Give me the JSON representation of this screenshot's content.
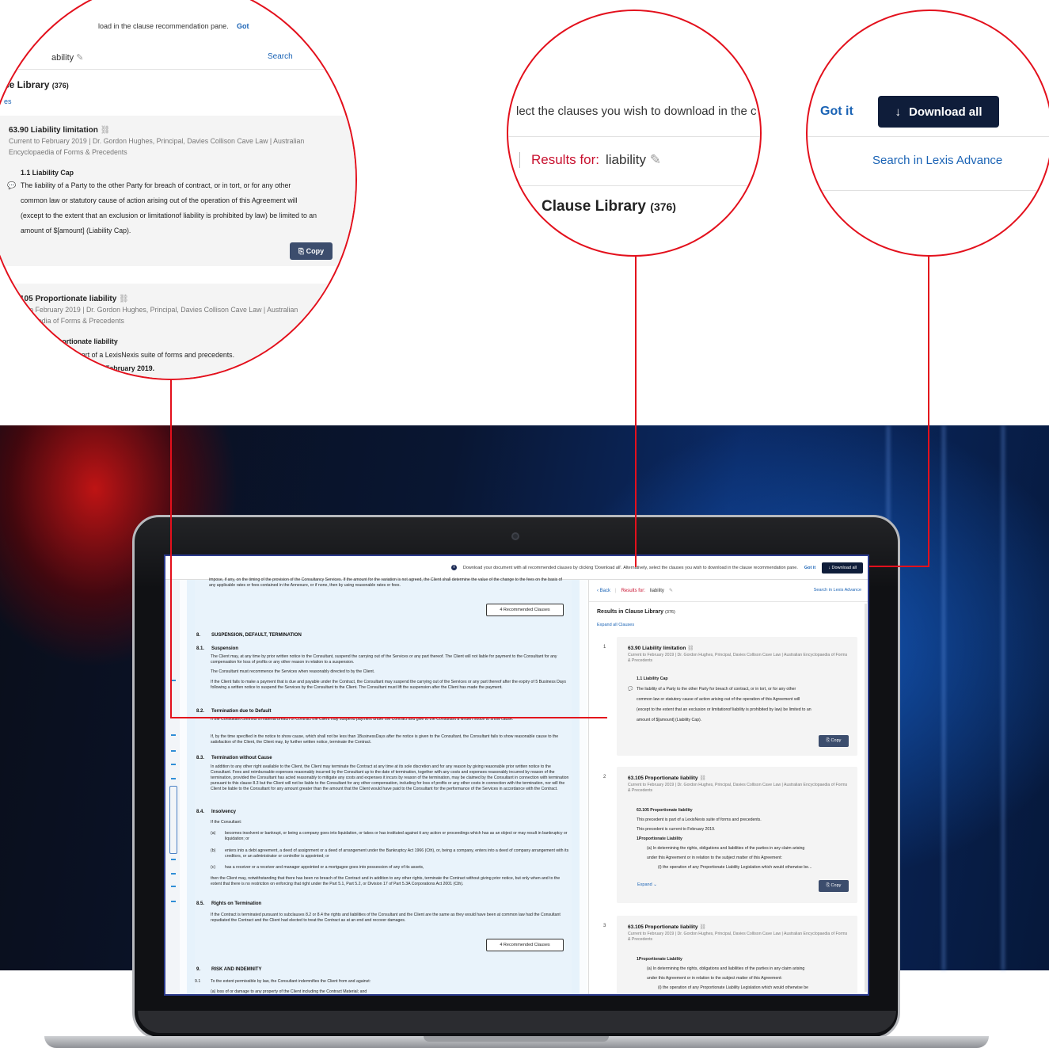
{
  "notice": {
    "text": "Download your document with all recommended clauses by clicking 'Download all'. Alternatively, select the clauses you wish to download in the clause recommendation pane.",
    "got_it": "Got it",
    "download_all": "Download all"
  },
  "doc": {
    "intro": "impose, if any, on the timing of the provision of the Consultancy Services. If the amount for the variation is not agreed, the Client shall determine the value of the change to the fees on the basis of any applicable rates or fees contained in the Annexure, or if none, then by using reasonable rates or fees.",
    "rec_button": "4 Recommended Clauses",
    "sec8_num": "8.",
    "sec8_title": "SUSPENSION, DEFAULT, TERMINATION",
    "s81_num": "8.1.",
    "s81_title": "Suspension",
    "s81_p1": "The Client may, at any time by prior written notice to the Consultant, suspend the carrying out of the Services or any part thereof. The Client will not liable for payment to the Consultant for any compensation for loss of profits or any other reason in relation to a suspension.",
    "s81_p2": "The Consultant must recommence the Services when reasonably directed to by the Client.",
    "s81_p3": "If the Client fails to make a payment that is due and payable under the Contract, the Consultant may suspend the carrying out of the Services or any part thereof after the expiry of 5 Business Days following a written notice to suspend the Services by the Consultant to the Client. The Consultant must lift the suspension after the Client has made the payment.",
    "s82_num": "8.2.",
    "s82_title": "Termination due to Default",
    "s82_p1": "If the Consultant commits a material breach of Contract the Client may suspend payment under the Contract and give to the Consultant a written notice to show cause.",
    "s82_p2": "If, by the time specified in the notice to show cause, which shall not be less than 1BusinessDays after the notice is given to the Consultant, the Consultant fails to show reasonable cause to the satisfaction of the Client, the Client may, by further written notice, terminate the Contract.",
    "s83_num": "8.3.",
    "s83_title": "Termination without Cause",
    "s83_p1": "In addition to any other right available to the Client, the Client may terminate the Contract at any time at its sole discretion and for any reason by giving reasonable prior written notice to the Consultant. Fees and reimbursable expenses reasonably incurred by the Consultant up to the date of termination, together with any costs and expenses reasonably incurred by reason of the termination, provided the Consultant has acted reasonably to mitigate any costs and expenses it incurs by reason of the termination, may be claimed by the Consultant in connection with termination pursuant to this clause 8.3 but the Client will not be liable to the Consultant for any other compensation, including for loss of profits or any other costs in connection with the termination, nor will the Client be liable to the Consultant for any amount greater than the amount that the Client would have paid to the Consultant for the performance of the Services in accordance with the Contract.",
    "s84_num": "8.4.",
    "s84_title": "Insolvency",
    "s84_lead": "If the Consultant:",
    "s84_a_lbl": "(a)",
    "s84_a": "becomes insolvent or bankrupt, or being a company goes into liquidation, or takes or has instituted against it any action or proceedings which has as an object or may result in bankruptcy or liquidation; or",
    "s84_b_lbl": "(b)",
    "s84_b": "enters into a debt agreement, a deed of assignment or a deed of arrangement under the Bankruptcy Act 1966 (Cth), or, being a company, enters into a deed of company arrangement with its creditors, or an administrator or controller is appointed; or",
    "s84_c_lbl": "(c)",
    "s84_c": "has a receiver or a receiver and manager appointed or a mortgagee goes into possession of any of its assets,",
    "s84_tail": "then the Client may, notwithstanding that there has been no breach of the Contract and in addition to any other rights, terminate the Contract without giving prior notice, but only when and to the extent that there is no restriction on enforcing that right under the Part 5.1, Part 5.2, or Division 17 of Part 5.3A Corporations Act 2001 (Cth).",
    "s85_num": "8.5.",
    "s85_title": "Rights on Termination",
    "s85_p1": "If the Contract is terminated pursuant to subclauses 8.2 or 8.4 the rights and liabilities of the Consultant and the Client are the same as they would have been at common law had the Consultant repudiated the Contract and the Client had elected to treat the Contract as at an end and recover damages.",
    "rec_button2": "4 Recommended Clauses",
    "sec9_num": "9.",
    "sec9_title": "RISK AND INDEMNITY",
    "s91_num": "9.1",
    "s91_p1": "To the extent permissible by law, the Consultant indemnifies the Client from and against:",
    "s91_a": "(a)    loss of or damage to any property of the Client including the Contract Material; and"
  },
  "rec": {
    "back": "Back",
    "sep": "|",
    "results_for": "Results for:",
    "query": "liability",
    "search_lexis": "Search in Lexis Advance",
    "title": "Results in Clause Library",
    "count": "(376)",
    "expand_all": "Expand all Clauses",
    "cards": [
      {
        "num": "1",
        "title": "63.90 Liability limitation",
        "meta": "Current to February 2019 | Dr. Gordon Hughes, Principal, Davies Collison Cave Law | Australian Encyclopaedia of Forms & Precedents",
        "sub": "1.1 Liability Cap",
        "body": [
          "The liability of a Party to the other Party for breach of contract, or in tort, or for any other",
          "common law or statutory cause of action arising out of the operation of this Agreement will",
          "(except to the extent that an exclusion or limitationof liability is prohibited by law) be limited to an",
          "amount of $[amount] (Liability Cap)."
        ],
        "copy": "Copy"
      },
      {
        "num": "2",
        "title": "63.105 Proportionate liability",
        "meta": "Current to February 2019 | Dr. Gordon Hughes, Principal, Davies Collison Cave Law | Australian Encyclopaedia of Forms & Precedents",
        "sub": "63.105 Proportionate liability",
        "body": [
          "This precedent is part of a LexisNexis suite of forms and precedents.",
          "This precedent is current to February 2019.",
          "1Proportionate Liability",
          "(a) In determining the rights, obligations and liabilities of the parties in any claim arising",
          "under this Agreement or in relation to the subject matter of this Agreement:",
          "(i) the operation of any Proportionate Liability Legislation which would otherwise be..."
        ],
        "expand": "Expand",
        "copy": "Copy"
      },
      {
        "num": "3",
        "title": "63.105 Proportionate liability",
        "meta": "Current to February 2019 | Dr. Gordon Hughes, Principal, Davies Collison Cave Law | Australian Encyclopaedia of Forms & Precedents",
        "body": [
          "1Proportionate Liability",
          "(a) In determining the rights, obligations and liabilities of the parties in any claim arising",
          "under this Agreement or in relation to the subject matter of this Agreement:",
          "(i) the operation of any Proportionate Liability Legislation which would otherwise be"
        ]
      }
    ]
  },
  "zoom1": {
    "notice_frag": "load in the clause recommendation pane.",
    "got_frag": "Got",
    "query_frag": "ability",
    "search_frag": "Search",
    "title_frag": "se Library",
    "count": "(376)",
    "expand_frag": "es",
    "c1_title": "63.90 Liability limitation",
    "c1_meta1": "Current to February 2019 | Dr. Gordon Hughes, Principal, Davies Collison Cave Law | Australian",
    "c1_meta2": "Encyclopaedia of Forms & Precedents",
    "c1_sub": "1.1 Liability Cap",
    "c1_l1": "The liability of a Party to the other Party for breach of contract, or in tort, or for any other",
    "c1_l2": "common law or statutory cause of action arising out of the operation of this Agreement will",
    "c1_l3": "(except to the extent that an exclusion or limitationof liability is prohibited by law) be limited to an",
    "c1_l4": "amount of $[amount] (Liability Cap).",
    "copy": "Copy",
    "c2_title": "105 Proportionate liability",
    "c2_meta1": "nt to February 2019 | Dr. Gordon Hughes, Principal, Davies Collison Cave Law | Australian",
    "c2_meta2": "aedia of Forms & Precedents",
    "c2_sub": "portionate liability",
    "c2_l1": "part of a LexisNexis suite of forms and precedents.",
    "c2_l2": "February 2019."
  },
  "zoom2": {
    "notice_frag": "lect the clauses you wish to download in the c",
    "results_for": "Results for:",
    "query": "liability",
    "title": "Clause Library",
    "count": "(376)"
  },
  "zoom3": {
    "got_it": "Got it",
    "download_all": "Download all",
    "search_lexis": "Search in Lexis Advance"
  },
  "colors": {
    "accent_red": "#e3101c",
    "navy": "#0f1d3a",
    "link_blue": "#1a63b5",
    "results_red": "#c8102e"
  }
}
